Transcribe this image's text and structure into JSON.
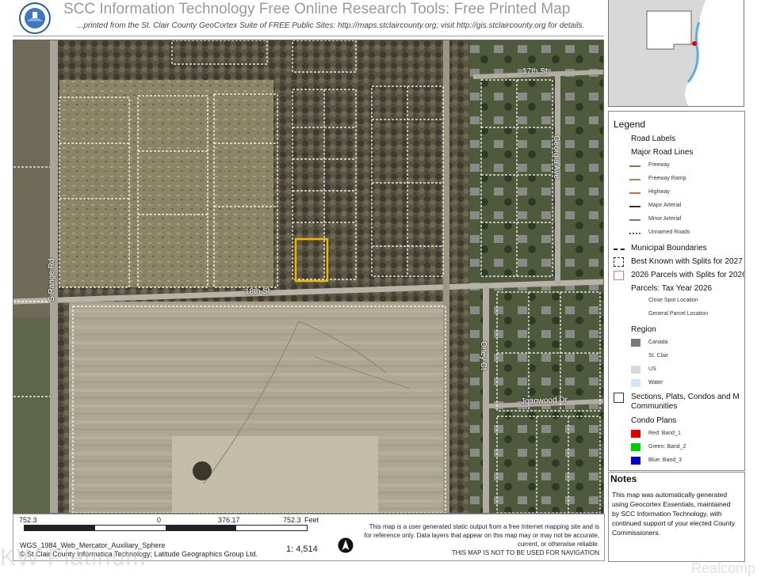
{
  "header": {
    "title": "SCC Information Technology Free Online Research Tools: Free Printed Map",
    "subtitle": "...printed from the St. Clair County GeoCortex Suite of FREE Public Sites: http://maps.stclaircounty.org; visit http://gis.stclaircounty.org for details.",
    "seal_text": "ST. CLAIR COUNTY MICHIGAN"
  },
  "map_labels": {
    "street_17th": "17th St",
    "street_18th": "18th St",
    "s_range_rd": "S Range Rd",
    "georgia_ave": "Georgia Ave",
    "orley_ct": "Orley Ct",
    "joanwood_dr": "Joanwood Dr"
  },
  "legend": {
    "title": "Legend",
    "road_labels": "Road Labels",
    "major_road_lines": "Major Road Lines",
    "freeway": "Freeway",
    "freeway_ramp": "Freeway Ramp",
    "highway": "Highway",
    "major_arterial": "Major Arterial",
    "minor_arterial": "Minor Arterial",
    "unnamed_roads": "Unnamed Roads",
    "municipal_boundaries": "Municipal Boundaries",
    "best_known_splits": "Best Known with Splits for 2027",
    "parcels_2026_splits": "2026 Parcels with Splits for 2026",
    "parcels_tax_year": "Parcels: Tax Year 2026",
    "close_spot": "Close Spot Location",
    "general_parcel": "General Parcel Location",
    "region": "Region",
    "canada": "Canada",
    "st_clair": "St. Clair",
    "us": "US",
    "water": "Water",
    "sections_plats": "Sections, Plats, Condos and M",
    "communities": "Communities",
    "condo_plans": "Condo Plans",
    "band_1": "Red: Band_1",
    "band_2": "Green: Band_2",
    "band_3": "Blue: Band_3"
  },
  "notes": {
    "title": "Notes",
    "text": "This map was automatically generated using Geocortex Essentials, maintained by SCC Information Technology, with continued support of your elected County Commissioners."
  },
  "footer": {
    "scale_left": "752.3",
    "scale_zero": "0",
    "scale_mid": "376.17",
    "scale_right": "752.3",
    "scale_unit": "Feet",
    "crs": "WGS_1984_Web_Mercator_Auxiliary_Sphere",
    "copyright": "© St Clair County Informatica Technology; Latitude Geographics Group Ltd.",
    "ratio": "1: 4,514",
    "disclaimer_1": "This map is a user generated static output from a free Internet mapping site and is for reference only. Data layers that appear on this map may or may not be accurate, current, or otherwise reliable.",
    "disclaimer_2": "THIS MAP IS NOT TO BE USED FOR NAVIGATION"
  },
  "watermark": {
    "left": "KW Platinum",
    "right": "Realcomp"
  },
  "colors": {
    "highlight_parcel": "#f5b400",
    "band_red": "#e00000",
    "band_green": "#00cc00",
    "band_blue": "#0000cc",
    "canada": "#7a7a7a",
    "us": "#d9d9d9",
    "water": "#cfe6f5",
    "inset_marker": "#e00000"
  }
}
